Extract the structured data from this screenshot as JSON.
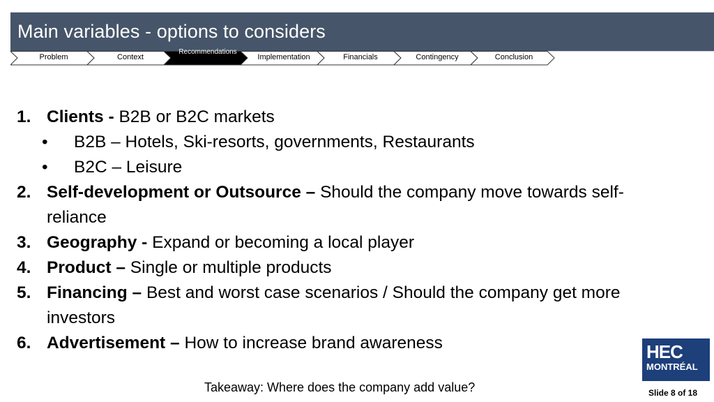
{
  "header": {
    "title": "Main variables - options to considers"
  },
  "nav": {
    "steps": [
      {
        "label": "Problem",
        "active": false
      },
      {
        "label": "Context",
        "active": false
      },
      {
        "label": "Recommendations",
        "active": true
      },
      {
        "label": "Implementation",
        "active": false
      },
      {
        "label": "Financials",
        "active": false
      },
      {
        "label": "Contingency",
        "active": false
      },
      {
        "label": "Conclusion",
        "active": false
      }
    ],
    "active_color": "#000000"
  },
  "content": {
    "items": [
      {
        "num": "1.",
        "bold": "Clients -",
        "text": " B2B or B2C markets",
        "sub": [
          {
            "bullet": "•",
            "text": "B2B – Hotels, Ski-resorts, governments, Restaurants"
          },
          {
            "bullet": "•",
            "text": "B2C – Leisure"
          }
        ]
      },
      {
        "num": "2.",
        "bold": "Self-development or Outsource –",
        "text": " Should the company move towards self-",
        "cont": "reliance"
      },
      {
        "num": "3.",
        "bold": "Geography -",
        "text": " Expand or becoming a local player"
      },
      {
        "num": "4.",
        "bold": "Product –",
        "text": " Single or multiple products"
      },
      {
        "num": "5.",
        "bold": "Financing –",
        "text": " Best and worst case scenarios / Should the company get more",
        "cont": "investors"
      },
      {
        "num": "6.",
        "bold": "Advertisement –",
        "text": " How to increase brand awareness"
      }
    ]
  },
  "footer": {
    "takeaway": "Takeaway: Where does the company add value?",
    "logo_line1": "HEC",
    "logo_line2": "MONTRÉAL",
    "slide_number": "Slide 8 of 18"
  },
  "colors": {
    "title_bar": "#465569",
    "logo_bg": "#1d3f7a"
  }
}
